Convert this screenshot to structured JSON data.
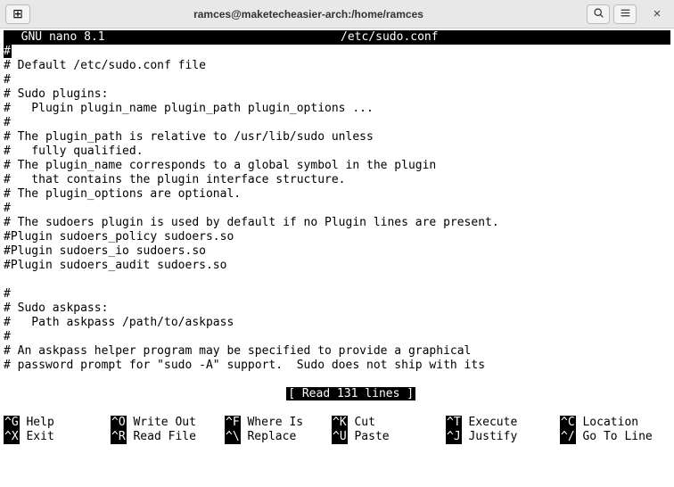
{
  "window": {
    "title": "ramces@maketecheasier-arch:/home/ramces"
  },
  "editor": {
    "app_name": "  GNU nano 8.1",
    "file_path": "/etc/sudo.conf",
    "lines": [
      "#",
      "# Default /etc/sudo.conf file",
      "#",
      "# Sudo plugins:",
      "#   Plugin plugin_name plugin_path plugin_options ...",
      "#",
      "# The plugin_path is relative to /usr/lib/sudo unless",
      "#   fully qualified.",
      "# The plugin_name corresponds to a global symbol in the plugin",
      "#   that contains the plugin interface structure.",
      "# The plugin_options are optional.",
      "#",
      "# The sudoers plugin is used by default if no Plugin lines are present.",
      "#Plugin sudoers_policy sudoers.so",
      "#Plugin sudoers_io sudoers.so",
      "#Plugin sudoers_audit sudoers.so",
      "",
      "#",
      "# Sudo askpass:",
      "#   Path askpass /path/to/askpass",
      "#",
      "# An askpass helper program may be specified to provide a graphical",
      "# password prompt for \"sudo -A\" support.  Sudo does not ship with its"
    ],
    "status": "[ Read 131 lines ]"
  },
  "shortcuts": {
    "row1": [
      {
        "key": "^G",
        "label": " Help"
      },
      {
        "key": "^O",
        "label": " Write Out"
      },
      {
        "key": "^F",
        "label": " Where Is"
      },
      {
        "key": "^K",
        "label": " Cut"
      },
      {
        "key": "^T",
        "label": " Execute"
      },
      {
        "key": "^C",
        "label": " Location"
      }
    ],
    "row2": [
      {
        "key": "^X",
        "label": " Exit"
      },
      {
        "key": "^R",
        "label": " Read File"
      },
      {
        "key": "^\\",
        "label": " Replace"
      },
      {
        "key": "^U",
        "label": " Paste"
      },
      {
        "key": "^J",
        "label": " Justify"
      },
      {
        "key": "^/",
        "label": " Go To Line"
      }
    ]
  }
}
